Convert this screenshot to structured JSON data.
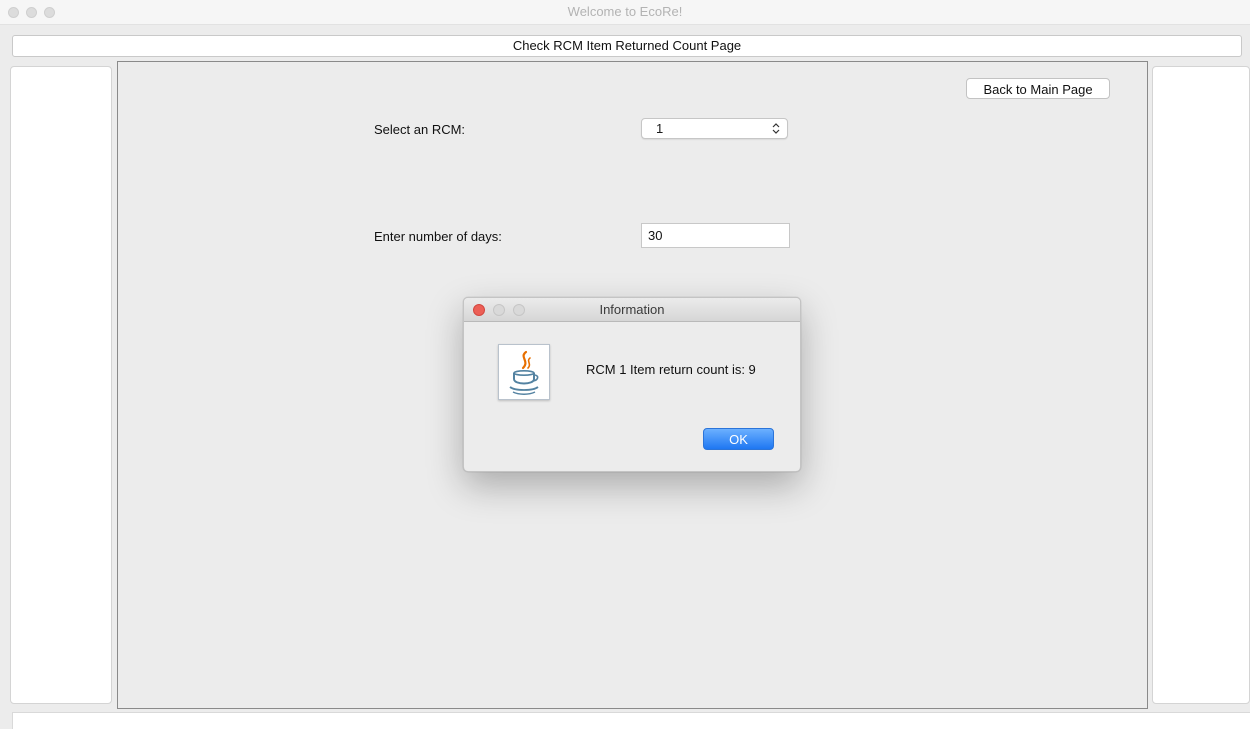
{
  "window": {
    "title": "Welcome to EcoRe!"
  },
  "page": {
    "header": "Check RCM Item Returned Count Page",
    "back_button": "Back to Main Page"
  },
  "form": {
    "rcm_label": "Select an RCM:",
    "rcm_selected": "1",
    "days_label": "Enter number of days:",
    "days_value": "30"
  },
  "dialog": {
    "title": "Information",
    "message": "RCM 1 Item return count is: 9",
    "ok_label": "OK",
    "icon": "java-coffee-cup-icon"
  },
  "colors": {
    "close_dot": "#ec5f56",
    "ok_button": "#1e77f2",
    "java_cup": "#e76f00",
    "java_steam": "#5382a1"
  }
}
